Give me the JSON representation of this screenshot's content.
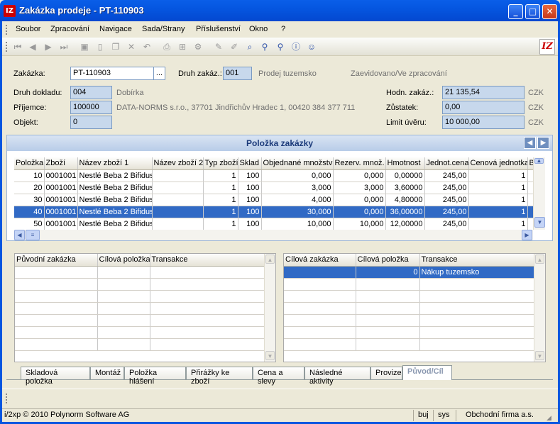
{
  "window": {
    "title": "Zakázka prodeje - PT-110903",
    "minimize": "_",
    "maximize": "□",
    "close": "✕"
  },
  "menu": [
    "Soubor",
    "Zpracování",
    "Navigace",
    "Sada/Strany",
    "Příslušenství",
    "Okno",
    "?"
  ],
  "form": {
    "zakazka_label": "Zakázka:",
    "zakazka_value": "PT-110903",
    "zakazka_btn": "...",
    "druh_zakazky_label": "Druh zakáz.:",
    "druh_zakazky_value": "001",
    "druh_zakazky_text": "Prodej tuzemsko",
    "status_text": "Zaevidovano/Ve zpracování",
    "druh_dokladu_label": "Druh dokladu:",
    "druh_dokladu_value": "004",
    "druh_dokladu_text": "Dobírka",
    "prijemce_label": "Příjemce:",
    "prijemce_value": "100000",
    "prijemce_text": "DATA-NORMS s.r.o., 37701 Jindřichův Hradec 1, 00420 384 377 711",
    "objekt_label": "Objekt:",
    "objekt_value": "0",
    "hodn_label": "Hodn. zakáz.:",
    "hodn_value": "21 135,54",
    "hodn_cur": "CZK",
    "zustatek_label": "Zůstatek:",
    "zustatek_value": "0,00",
    "zustatek_cur": "CZK",
    "limit_label": "Limit úvěru:",
    "limit_value": "10 000,00",
    "limit_cur": "CZK"
  },
  "items_panel": {
    "title": "Položka zakázky",
    "prev": "◀",
    "next": "▶",
    "columns": [
      "Položka",
      "Zboží",
      "Název zboží 1",
      "Název zboží 2",
      "Typ zboží",
      "Sklad",
      "Objednané množství",
      "Rezerv. množ.",
      "Hmotnost",
      "Jednot.cena",
      "Cenová jednotka",
      "B"
    ],
    "rows": [
      [
        "10",
        "0001001",
        "Nestlé Beba 2 Bifidus",
        "",
        "1",
        "100",
        "0,000",
        "0,000",
        "0,00000",
        "245,00",
        "1",
        ""
      ],
      [
        "20",
        "0001001",
        "Nestlé Beba 2 Bifidus",
        "",
        "1",
        "100",
        "3,000",
        "3,000",
        "3,60000",
        "245,00",
        "1",
        ""
      ],
      [
        "30",
        "0001001",
        "Nestlé Beba 2 Bifidus",
        "",
        "1",
        "100",
        "4,000",
        "0,000",
        "4,80000",
        "245,00",
        "1",
        ""
      ],
      [
        "40",
        "0001001",
        "Nestlé Beba 2 Bifidus",
        "",
        "1",
        "100",
        "30,000",
        "0,000",
        "36,00000",
        "245,00",
        "1",
        ""
      ],
      [
        "50",
        "0001001",
        "Nestlé Beba 2 Bifidus",
        "",
        "1",
        "100",
        "10,000",
        "10,000",
        "12,00000",
        "245,00",
        "1",
        ""
      ]
    ],
    "selected_row": 3
  },
  "left_grid": {
    "columns": [
      "Původní zakázka",
      "Cílová položka",
      "Transakce"
    ]
  },
  "right_grid": {
    "columns": [
      "Cílová zakázka",
      "Cílová položka",
      "Transakce"
    ],
    "rows": [
      [
        "",
        "0",
        "Nákup tuzemsko"
      ]
    ]
  },
  "tabs": [
    "Skladová položka",
    "Montáž",
    "Položka hlášení",
    "Přirážky ke zboží",
    "Cena a slevy",
    "Následné aktivity",
    "Provize",
    "Původ/Cíl"
  ],
  "active_tab": 7,
  "status": {
    "copyright": "i/2xp © 2010 Polynorm Software AG",
    "user": "buj",
    "system": "sys",
    "company": "Obchodní firma a.s."
  }
}
